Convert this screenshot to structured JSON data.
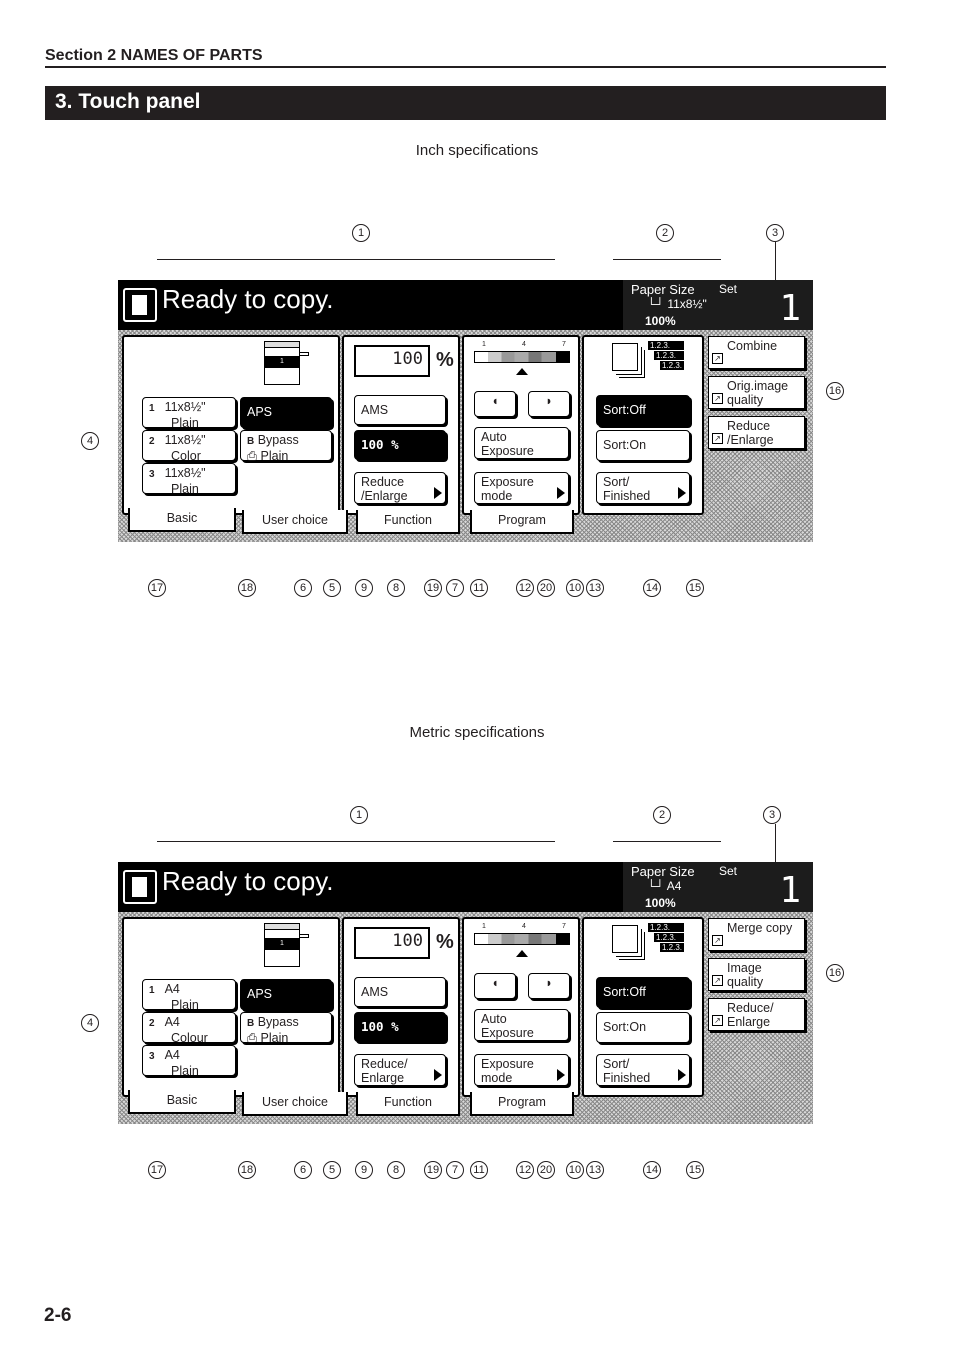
{
  "header": {
    "section": "Section 2  NAMES OF PARTS",
    "title": "3.   Touch panel",
    "page_number": "2-6"
  },
  "diagrams": [
    {
      "spec_label": "Inch specifications",
      "status": {
        "message": "Ready to copy.",
        "paper_size_label": "Paper Size",
        "set_label": "Set",
        "paper_size_value": "11x8½\"",
        "zoom_value": "100%",
        "copy_count": "1"
      },
      "basic": {
        "trays": [
          {
            "num": "1",
            "size": "11x8½\"",
            "type": "Plain"
          },
          {
            "num": "2",
            "size": "11x8½\"",
            "type": "Color"
          },
          {
            "num": "3",
            "size": "11x8½\"",
            "type": "Plain"
          }
        ],
        "aps": "APS",
        "bypass_letter": "B",
        "bypass": "Bypass",
        "bypass_type": "Plain"
      },
      "zoom": {
        "value": "100",
        "pct_symbol": "%",
        "ams": "AMS",
        "preset": "100 %",
        "reduce_enlarge": "Reduce /Enlarge"
      },
      "exposure": {
        "scale": [
          "1",
          "4",
          "7"
        ],
        "auto": "Auto Exposure",
        "mode": "Exposure mode"
      },
      "sort": {
        "tags": [
          "1.2.3.",
          "1.2.3.",
          "1.2.3."
        ],
        "off": "Sort:Off",
        "on": "Sort:On",
        "finished": "Sort/ Finished"
      },
      "side": [
        "Combine",
        "Orig.image quality",
        "Reduce /Enlarge"
      ],
      "tabs": [
        "Basic",
        "User choice",
        "Function",
        "Program"
      ],
      "callouts_top": [
        "1",
        "2",
        "3"
      ],
      "callouts_side": [
        "4",
        "16"
      ],
      "callouts_bottom": [
        "17",
        "18",
        "6",
        "5",
        "9",
        "8",
        "19",
        "7",
        "11",
        "12",
        "20",
        "10",
        "13",
        "14",
        "15"
      ]
    },
    {
      "spec_label": "Metric specifications",
      "status": {
        "message": "Ready to copy.",
        "paper_size_label": "Paper Size",
        "set_label": "Set",
        "paper_size_value": "A4",
        "zoom_value": "100%",
        "copy_count": "1"
      },
      "basic": {
        "trays": [
          {
            "num": "1",
            "size": "A4",
            "type": "Plain"
          },
          {
            "num": "2",
            "size": "A4",
            "type": "Colour"
          },
          {
            "num": "3",
            "size": "A4",
            "type": "Plain"
          }
        ],
        "aps": "APS",
        "bypass_letter": "B",
        "bypass": "Bypass",
        "bypass_type": "Plain"
      },
      "zoom": {
        "value": "100",
        "pct_symbol": "%",
        "ams": "AMS",
        "preset": "100 %",
        "reduce_enlarge": "Reduce/ Enlarge"
      },
      "exposure": {
        "scale": [
          "1",
          "4",
          "7"
        ],
        "auto": "Auto Exposure",
        "mode": "Exposure mode"
      },
      "sort": {
        "tags": [
          "1.2.3.",
          "1.2.3.",
          "1.2.3."
        ],
        "off": "Sort:Off",
        "on": "Sort:On",
        "finished": "Sort/ Finished"
      },
      "side": [
        "Merge copy",
        "Image quality",
        "Reduce/ Enlarge"
      ],
      "tabs": [
        "Basic",
        "User choice",
        "Function",
        "Program"
      ],
      "callouts_top": [
        "1",
        "2",
        "3"
      ],
      "callouts_side": [
        "4",
        "16"
      ],
      "callouts_bottom": [
        "17",
        "18",
        "6",
        "5",
        "9",
        "8",
        "19",
        "7",
        "11",
        "12",
        "20",
        "10",
        "13",
        "14",
        "15"
      ]
    }
  ]
}
